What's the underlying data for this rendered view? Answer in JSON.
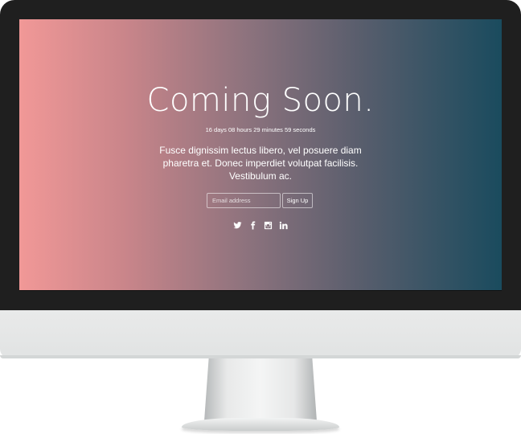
{
  "hero": {
    "title": "Coming Soon.",
    "countdown": "16 days 08 hours 29 minutes 59 seconds",
    "description": "Fusce dignissim lectus libero, vel posuere diam pharetra et. Donec imperdiet volutpat facilisis. Vestibulum ac."
  },
  "signup": {
    "email_placeholder": "Email address",
    "email_value": "",
    "button_label": "Sign Up"
  },
  "social": {
    "icons": [
      "twitter-icon",
      "facebook-icon",
      "instagram-icon",
      "linkedin-icon"
    ]
  },
  "colors": {
    "gradient_start": "#f19897",
    "gradient_end": "#1a4b5e",
    "bezel": "#1f1f1f",
    "chin": "#e6e8e8",
    "text": "#ffffff"
  }
}
